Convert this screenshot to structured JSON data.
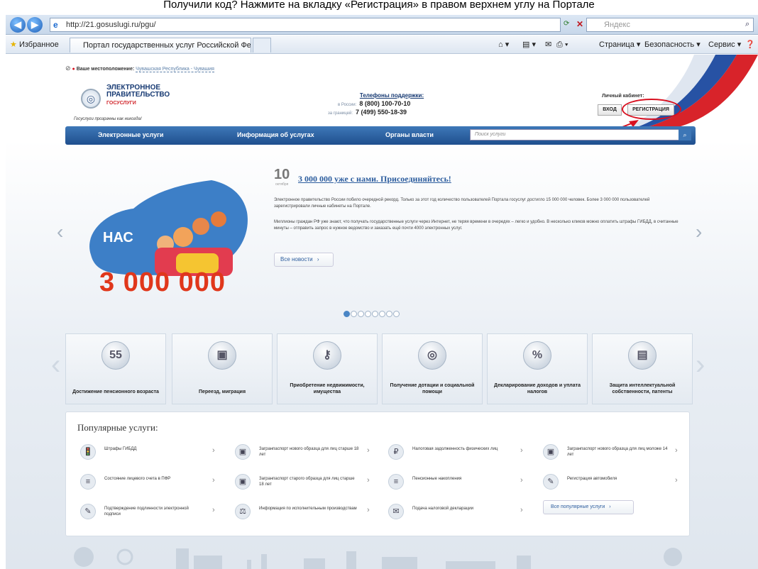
{
  "caption": "Получили код? Нажмите на вкладку «Регистрация» в правом верхнем углу на Портале",
  "browser": {
    "window_title": "Портал государственных услуг Российской Федерации - Windows Internet Explorer",
    "url": "http://21.gosuslugi.ru/pgu/",
    "search_placeholder": "Яндекс",
    "favorites_label": "Избранное",
    "tab_title": "Портал государственных услуг Российской Фе...",
    "commands": {
      "page": "Страница ▾",
      "security": "Безопасность ▾",
      "service": "Сервис ▾"
    }
  },
  "header": {
    "location_label": "Ваше местоположение:",
    "location_value": "Чувашская Республика - Чувашия",
    "logo_line1": "ЭЛЕКТРОННОЕ ПРАВИТЕЛЬСТВО",
    "logo_line2": "ГОСУСЛУГИ",
    "tagline": "Госуслуги прозрачны как никогда!",
    "phones_title": "Телефоны поддержки:",
    "phone_russia_label": "в России:",
    "phone_russia": "8 (800) 100-70-10",
    "phone_abroad_label": "за границей:",
    "phone_abroad": "7 (499) 550-18-39",
    "cabinet_title": "Личный кабинет:",
    "login_label": "ВХОД",
    "register_label": "РЕГИСТРАЦИЯ"
  },
  "menu": {
    "items": [
      "Электронные услуги",
      "Информация об услугах",
      "Органы власти"
    ],
    "search_placeholder": "Поиск услуги"
  },
  "promo": {
    "badge_word": "НАС",
    "big_number": "3 000 000",
    "day": "10",
    "month": "октября",
    "title": "3 000 000 уже с нами. Присоединяйтесь!",
    "paragraph1": "Электронное правительство России побило очередной рекорд. Только за этот год количество пользователей Портала госуслуг достигло 15 000 000 человек. Более 3 000 000 пользователей зарегистрировали личные кабинеты на Портале.",
    "paragraph2": "Миллионы граждан РФ уже знают, что получать государственные услуги через Интернет, не теряя времени в очередях – легко и удобно. В несколько кликов можно оплатить штрафы ГИБДД, в считанные минуты – отправить запрос в нужное ведомство и заказать ещё почти 4000 электронных услуг.",
    "all_news": "Все новости",
    "slide_count": 8,
    "active_slide": 1
  },
  "categories": [
    {
      "label": "Достижение пенсионного возраста",
      "icon": "55"
    },
    {
      "label": "Переезд, миграция",
      "icon": "▣"
    },
    {
      "label": "Приобретение недвижимости, имущества",
      "icon": "⚷"
    },
    {
      "label": "Получение дотации и социальной помощи",
      "icon": "◎"
    },
    {
      "label": "Декларирование доходов и уплата налогов",
      "icon": "%"
    },
    {
      "label": "Защита интеллектуальной собственности, патенты",
      "icon": "▤"
    }
  ],
  "popular": {
    "title": "Популярные услуги:",
    "items": [
      {
        "label": "Штрафы ГИБДД",
        "icon": "🚦"
      },
      {
        "label": "Загранпаспорт нового образца для лиц старше 18 лет",
        "icon": "▣"
      },
      {
        "label": "Налоговая задолженность физических лиц",
        "icon": "₽"
      },
      {
        "label": "Загранпаспорт нового образца для лиц моложе 14 лет",
        "icon": "▣"
      },
      {
        "label": "Состояние лицевого счета в ПФР",
        "icon": "≡"
      },
      {
        "label": "Загранпаспорт старого образца для лиц старше 18 лет",
        "icon": "▣"
      },
      {
        "label": "Пенсионные накопления",
        "icon": "≡"
      },
      {
        "label": "Регистрация автомобиля",
        "icon": "✎"
      },
      {
        "label": "Подтверждение подлинности электронной подписи",
        "icon": "✎"
      },
      {
        "label": "Информация по исполнительным производствам",
        "icon": "⚖"
      },
      {
        "label": "Подача налоговой декларации",
        "icon": "✉"
      }
    ],
    "all_label": "Все популярные услуги"
  },
  "colors": {
    "menu_blue": "#2a5d9f",
    "accent_red": "#e0371b",
    "annotation_red": "#d8101f"
  }
}
